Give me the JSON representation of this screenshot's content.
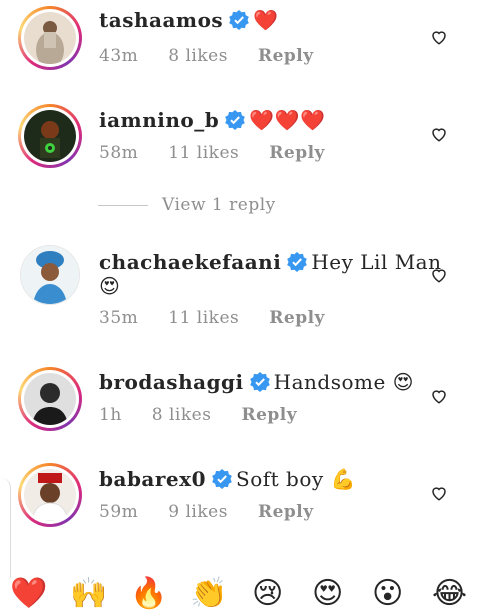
{
  "comments": [
    {
      "username": "tashaamos",
      "text": "",
      "emoji": "❤️",
      "time": "43m",
      "likes": "8 likes",
      "reply": "Reply"
    },
    {
      "username": "iamnino_b",
      "text": "",
      "emoji": "❤️❤️❤️",
      "time": "58m",
      "likes": "11 likes",
      "reply": "Reply"
    },
    {
      "username": "chachaekefaani",
      "text": "Hey Lil Man",
      "emoji": "😍",
      "time": "35m",
      "likes": "11 likes",
      "reply": "Reply"
    },
    {
      "username": "brodashaggi",
      "text": "Handsome",
      "emoji": "😍",
      "time": "1h",
      "likes": "8 likes",
      "reply": "Reply"
    },
    {
      "username": "babarex0",
      "text": "Soft boy",
      "emoji": "💪",
      "time": "59m",
      "likes": "9 likes",
      "reply": "Reply"
    }
  ],
  "view_replies": "View 1 reply",
  "quick_reactions": [
    "❤️",
    "🙌",
    "🔥",
    "👏",
    "😢",
    "😍",
    "😮",
    "😂"
  ],
  "colors": {
    "verified": "#3897f0",
    "heart": "#e11d2e",
    "meta": "#8e8e8e"
  }
}
